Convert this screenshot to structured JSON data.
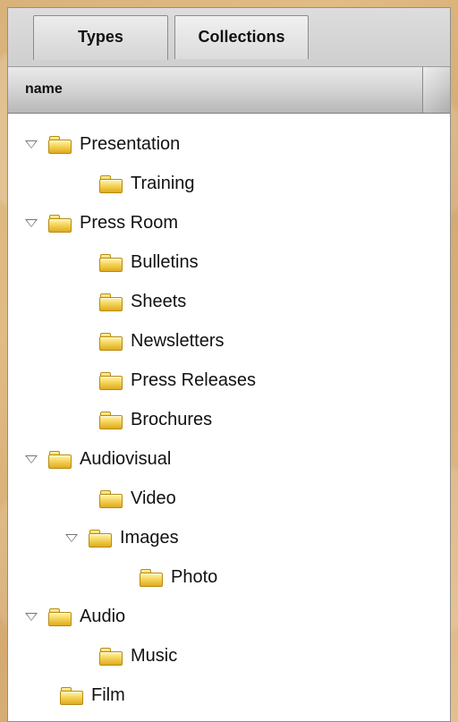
{
  "tabs": [
    {
      "label": "Types",
      "active": true
    },
    {
      "label": "Collections",
      "active": false
    }
  ],
  "tree": {
    "column_header": "name",
    "items": [
      {
        "label": "Presentation",
        "expanded": true
      },
      {
        "label": "Training"
      },
      {
        "label": "Press Room",
        "expanded": true
      },
      {
        "label": "Bulletins"
      },
      {
        "label": "Sheets"
      },
      {
        "label": "Newsletters"
      },
      {
        "label": "Press Releases"
      },
      {
        "label": "Brochures"
      },
      {
        "label": "Audiovisual",
        "expanded": true
      },
      {
        "label": "Video"
      },
      {
        "label": "Images",
        "expanded": true
      },
      {
        "label": "Photo"
      },
      {
        "label": "Audio",
        "expanded": true
      },
      {
        "label": "Music"
      },
      {
        "label": "Film"
      }
    ]
  },
  "icons": {
    "disclosure": "chevron-down-icon",
    "folder": "folder-icon"
  },
  "colors": {
    "background": "#ddb57a",
    "folder_yellow": "#f2cc45",
    "header_gray": "#c9c9c9"
  }
}
